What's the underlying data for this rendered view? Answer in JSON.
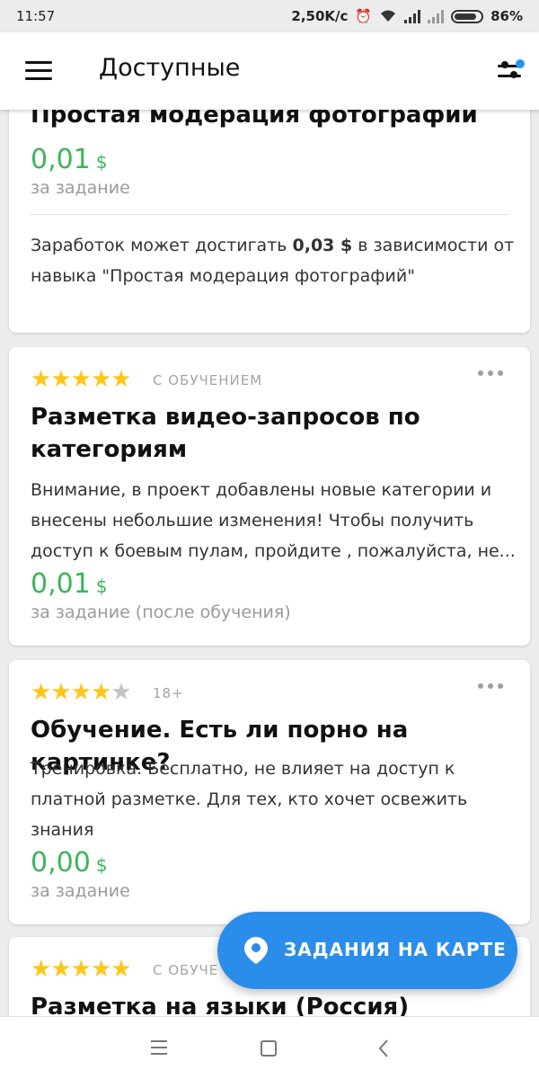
{
  "status_bar": {
    "time": "11:57",
    "speed": "2,50K/c",
    "alarm_icon": "alarm-icon",
    "wifi_icon": "wifi-icon",
    "signal_icon": "signal-icon",
    "battery_percent": "86%",
    "battery_level": 0.86
  },
  "app_bar": {
    "title": "Доступные",
    "menu_icon": "hamburger-menu-icon",
    "filter_icon": "filter-sliders-icon",
    "filter_dot_color": "#2196f3"
  },
  "cards": [
    {
      "title": "Простая модерация фотографий",
      "price": "0,01",
      "currency": "$",
      "per_task": "за задание",
      "earnings_prefix": "Заработок может достигать ",
      "earnings_amount": "0,03 $",
      "earnings_suffix": " в зависимости от навыка \"Простая модерация фотографий\""
    },
    {
      "stars": 5,
      "tag": "С ОБУЧЕНИЕМ",
      "title_line1": "Разметка видео-запросов по",
      "title_line2": "категориям",
      "desc_line1": "Внимание, в проект добавлены новые категории и",
      "desc_line2": "внесены небольшие изменения! Чтобы получить",
      "desc_line3": "доступ к боевым пулам, пройдите , пожалуйста, не...",
      "price": "0,01",
      "currency": "$",
      "per_task": "за задание (после обучения)"
    },
    {
      "stars": 4,
      "tag": "18+",
      "title": "Обучение. Есть ли порно на картинке?",
      "desc_line1": "Тренировка. Бесплатно, не влияет на доступ к",
      "desc_line2": "платной разметке. Для тех, кто хочет освежить",
      "desc_line3": "знания",
      "price": "0,00",
      "currency": "$",
      "per_task": "за задание"
    },
    {
      "stars": 5,
      "tag": "С ОБУЧЕ",
      "title": "Разметка на языки (Россия)"
    }
  ],
  "fab": {
    "label": "ЗАДАНИЯ НА КАРТЕ",
    "icon": "map-pin-icon"
  },
  "nav_bar": {
    "menu_icon": "nav-menu-icon",
    "home_icon": "nav-home-icon",
    "back_icon": "nav-back-icon"
  },
  "colors": {
    "accent": "#2a8dea",
    "price_green": "#3cb55a",
    "star_yellow": "#ffc61a"
  }
}
